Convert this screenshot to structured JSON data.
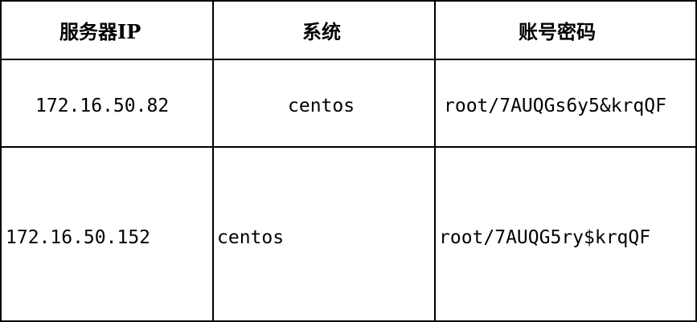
{
  "table": {
    "headers": [
      "服务器IP",
      "系统",
      "账号密码"
    ],
    "rows": [
      {
        "ip": "172.16.50.82",
        "os": "centos",
        "credentials": "root/7AUQGs6y5&krqQF"
      },
      {
        "ip": "172.16.50.152",
        "os": "centos",
        "credentials": "root/7AUQG5ry$krqQF"
      }
    ]
  },
  "colors": {
    "border": "#000000",
    "text": "#000000",
    "background": "#ffffff"
  }
}
